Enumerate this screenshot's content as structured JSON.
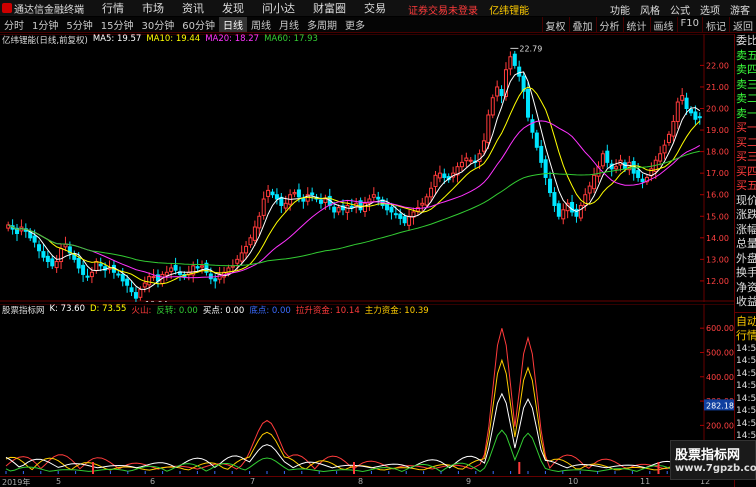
{
  "menubar": {
    "app_title": "通达信金融终端",
    "menus": [
      "行情",
      "市场",
      "资讯",
      "发现",
      "问小达",
      "财富圈",
      "交易"
    ],
    "notice": "证券交易未登录",
    "stock_name": "亿纬锂能",
    "right": [
      "功能",
      "风格",
      "公式",
      "选项",
      "游客"
    ]
  },
  "toolbar": {
    "timeframes": [
      "分时",
      "1分钟",
      "5分钟",
      "15分钟",
      "30分钟",
      "60分钟",
      "日线",
      "周线",
      "月线",
      "多周期",
      "更多"
    ],
    "active_timeframe": "日线",
    "buttons": [
      "复权",
      "叠加",
      "分析",
      "统计",
      "画线",
      "F10",
      "标记",
      "返回"
    ]
  },
  "main_chart": {
    "title": "亿纬锂能(日线,前复权)",
    "ma": [
      {
        "label": "MA5: 19.57",
        "color": "#ffffff"
      },
      {
        "label": "MA10: 19.44",
        "color": "#ffff00"
      },
      {
        "label": "MA20: 18.27",
        "color": "#ff33ff"
      },
      {
        "label": "MA60: 17.93",
        "color": "#33cc33"
      }
    ],
    "high_label": "22.79",
    "low_label": "10.94",
    "price_ticks": [
      "22.00",
      "21.00",
      "20.00",
      "19.00",
      "18.00",
      "17.00",
      "16.00",
      "15.00",
      "14.00",
      "13.00",
      "12.00"
    ]
  },
  "indicator": {
    "title": "股票指标网",
    "items": [
      {
        "label": "K: 73.60",
        "color": "#ffffff"
      },
      {
        "label": "D: 73.55",
        "color": "#ffff00"
      },
      {
        "label": "火山: ",
        "color": "#ff3b3b"
      },
      {
        "label": "反转: 0.00",
        "color": "#33cc33"
      },
      {
        "label": "买点: 0.00",
        "color": "#ffffff"
      },
      {
        "label": "底点: 0.00",
        "color": "#3b6bff"
      },
      {
        "label": "拉升资金: 10.14",
        "color": "#ff3b3b"
      },
      {
        "label": "主力资金: 10.39",
        "color": "#ffcc00"
      }
    ],
    "ticks": [
      "600.00",
      "500.00",
      "400.00",
      "300.00",
      "200.00",
      "100.00"
    ],
    "current": "282.18"
  },
  "time_axis": {
    "year": "2019年",
    "months": [
      "5",
      "6",
      "7",
      "8",
      "9",
      "10",
      "11",
      "12"
    ]
  },
  "side_panel": {
    "top_labels": [
      "委比",
      "卖五",
      "卖四",
      "卖三",
      "卖二",
      "卖一",
      "买一",
      "买二",
      "买三",
      "买四",
      "买五",
      "现价",
      "涨跌",
      "涨幅",
      "总量",
      "外盘",
      "换手",
      "净资",
      "收益"
    ],
    "bottom_labels": [
      "自动",
      "行情",
      "14:50",
      "14:50",
      "14:50",
      "14:50",
      "14:50",
      "14:50",
      "14:50",
      "14:50",
      "14:50",
      "14:50"
    ]
  },
  "watermark": {
    "line1": "股票指标网",
    "line2": "www.7gpzb.com"
  },
  "chart_data": [
    {
      "type": "candlestick",
      "title": "亿纬锂能(日线,前复权)",
      "ylim": [
        11.3,
        22.9
      ],
      "annotations": [
        "22.79",
        "10.94"
      ],
      "close": [
        14.6,
        14.4,
        14.2,
        14.5,
        14.3,
        14.0,
        13.8,
        13.4,
        13.1,
        12.9,
        12.7,
        12.9,
        13.5,
        13.7,
        13.3,
        13.0,
        12.6,
        12.3,
        12.2,
        12.4,
        12.9,
        12.7,
        12.5,
        12.6,
        12.4,
        12.3,
        12.0,
        11.8,
        11.5,
        11.2,
        11.6,
        11.9,
        12.2,
        12.2,
        12.0,
        12.3,
        12.4,
        12.6,
        12.5,
        12.3,
        12.2,
        12.4,
        12.7,
        12.6,
        12.7,
        12.4,
        12.1,
        12.0,
        12.3,
        12.4,
        12.6,
        12.7,
        13.0,
        13.3,
        13.6,
        14.0,
        14.5,
        15.0,
        15.8,
        16.2,
        16.0,
        15.8,
        15.5,
        15.6,
        16.0,
        16.1,
        15.9,
        15.7,
        16.0,
        16.0,
        15.8,
        15.6,
        15.8,
        15.5,
        15.2,
        15.4,
        15.3,
        15.5,
        15.4,
        15.6,
        15.3,
        15.6,
        15.8,
        16.0,
        15.8,
        15.5,
        15.3,
        15.2,
        15.1,
        14.9,
        14.7,
        15.0,
        15.2,
        15.4,
        15.6,
        15.9,
        16.3,
        16.9,
        17.0,
        16.8,
        16.7,
        17.0,
        17.3,
        17.5,
        17.7,
        17.6,
        17.5,
        17.9,
        18.5,
        19.7,
        20.5,
        21.0,
        20.6,
        21.8,
        22.4,
        22.0,
        21.5,
        20.8,
        19.6,
        18.9,
        18.2,
        17.5,
        16.8,
        16.1,
        15.5,
        15.0,
        15.3,
        15.6,
        15.2,
        15.0,
        15.5,
        16.0,
        16.4,
        16.9,
        17.3,
        17.9,
        17.5,
        17.2,
        17.3,
        17.6,
        17.2,
        17.5,
        17.0,
        16.8,
        16.6,
        16.8,
        17.2,
        17.6,
        17.9,
        18.3,
        18.8,
        19.4,
        20.3,
        20.6,
        20.0,
        19.8,
        19.5,
        19.6
      ],
      "series": [
        {
          "name": "MA5",
          "value": 19.57
        },
        {
          "name": "MA10",
          "value": 19.44
        },
        {
          "name": "MA20",
          "value": 18.27
        },
        {
          "name": "MA60",
          "value": 17.93
        }
      ]
    },
    {
      "type": "line",
      "title": "股票指标网",
      "ylim": [
        0,
        650
      ],
      "series": [
        {
          "name": "K",
          "value": 73.6
        },
        {
          "name": "D",
          "value": 73.55
        },
        {
          "name": "拉升资金",
          "value": 10.14
        },
        {
          "name": "主力资金",
          "value": 10.39
        }
      ],
      "peaks": [
        {
          "x": "7",
          "value": 220
        },
        {
          "x": "9",
          "value": 600
        },
        {
          "x": "9",
          "value": 560
        }
      ]
    }
  ]
}
